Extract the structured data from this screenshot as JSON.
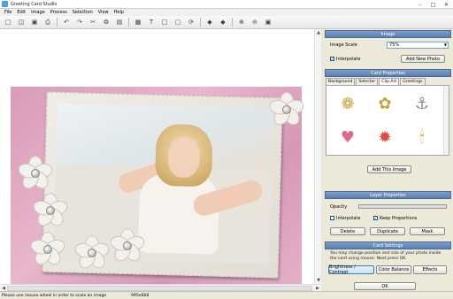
{
  "window": {
    "title": "Greeting Card Studio",
    "controls": [
      "–",
      "□",
      "✕"
    ]
  },
  "menu": [
    "File",
    "Edit",
    "Image",
    "Process",
    "Selection",
    "View",
    "Help"
  ],
  "toolbar": [
    "new-icon",
    "open-icon",
    "save-icon",
    "print-icon",
    "undo-icon",
    "redo-icon",
    "cut-icon",
    "copy-icon",
    "paste-icon",
    "image-icon",
    "text-icon",
    "crop-icon",
    "select-icon",
    "rotate-icon",
    "back-icon",
    "forward-icon",
    "zoom-in-icon",
    "zoom-out-icon",
    "fit-icon"
  ],
  "status": {
    "message": "Please use mouse wheel in order to scale an image",
    "dimensions": "995x668"
  },
  "image_panel": {
    "header": "Image",
    "scale_label": "Image Scale",
    "scale_value": "75%",
    "interpolate_label": "Interpolate",
    "interpolate_checked": true,
    "add_photo_label": "Add New Photo"
  },
  "card_props": {
    "header": "Card Properties",
    "tabs": [
      "Background",
      "Selector",
      "Clip Art",
      "Greetings"
    ],
    "selected_tab": "Clip Art",
    "clipart": [
      "gold-brooch",
      "gold-brooch-2",
      "anchor",
      "heart-balloon",
      "explosion",
      "candle"
    ],
    "add_image_label": "Add This Image"
  },
  "layer_props": {
    "header": "Layer Properties",
    "opacity_label": "Opacity",
    "opacity_value": 1.0,
    "interpolate_label": "Interpolate",
    "interpolate_checked": false,
    "keep_props_label": "Keep Proportions",
    "keep_props_checked": true,
    "delete_label": "Delete",
    "duplicate_label": "Duplicate",
    "mask_label": "Mask"
  },
  "card_settings": {
    "header": "Card Settings",
    "info": "You may change position and size of your photo inside the card using mouse. Next press OK.",
    "brightness_label": "Brightness / Contrast",
    "color_balance_label": "Color Balance",
    "effects_label": "Effects",
    "ok_label": "OK"
  },
  "colors": {
    "card_pink": "#e0a9c3",
    "panel_header": "#6b8dbd",
    "frame": "#ebe8e1"
  }
}
